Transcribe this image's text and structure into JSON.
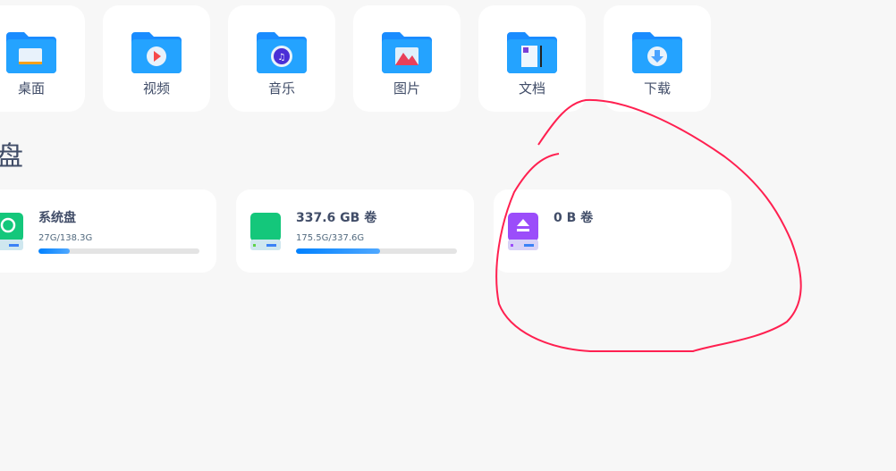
{
  "quick_access": [
    {
      "label": "桌面",
      "icon": "desktop-folder-icon"
    },
    {
      "label": "视频",
      "icon": "video-folder-icon"
    },
    {
      "label": "音乐",
      "icon": "music-folder-icon"
    },
    {
      "label": "图片",
      "icon": "pictures-folder-icon"
    },
    {
      "label": "文档",
      "icon": "documents-folder-icon"
    },
    {
      "label": "下载",
      "icon": "downloads-folder-icon"
    }
  ],
  "disks_heading": "磁盘",
  "disks": [
    {
      "name": "系统盘",
      "usage": "27G/138.3G",
      "fraction": 0.195,
      "color": "#14c77b"
    },
    {
      "name": "337.6 GB 卷",
      "usage": "175.5G/337.6G",
      "fraction": 0.52,
      "color": "#14c77b"
    },
    {
      "name": "0 B 卷",
      "usage": "",
      "fraction": null,
      "color": "#9b4dfa"
    }
  ],
  "annotation_color": "#ff2050"
}
